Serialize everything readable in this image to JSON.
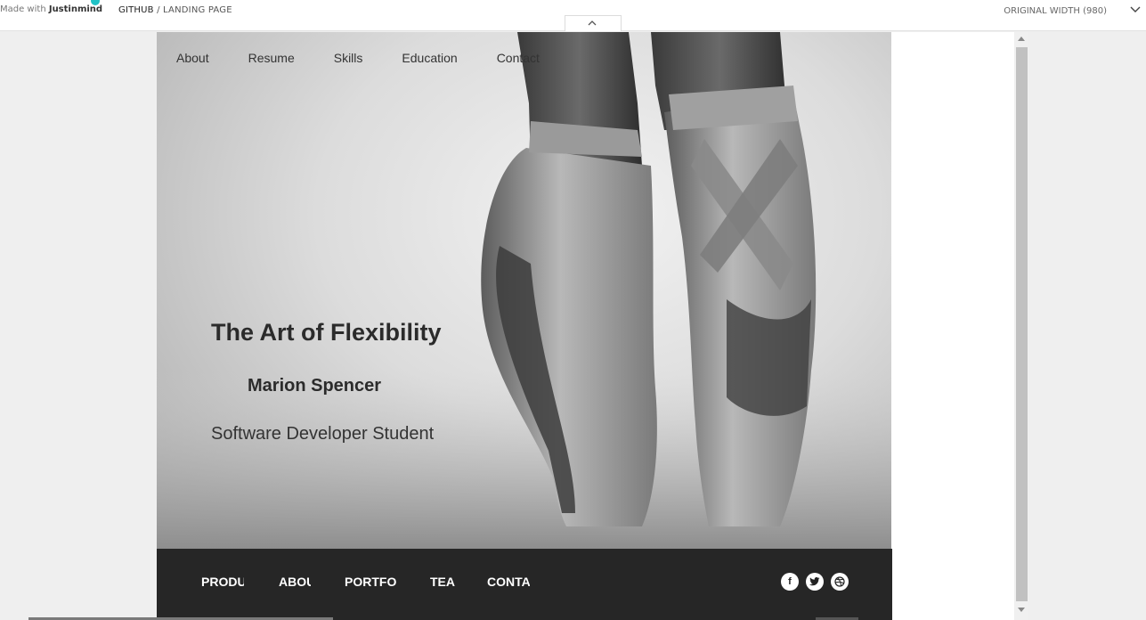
{
  "topbar": {
    "brand_prefix": "Made with",
    "brand_name": "Justinmind",
    "crumb_project": "GITHUB",
    "crumb_sep": " / ",
    "crumb_page": "LANDING PAGE",
    "width_label": "ORIGINAL WIDTH (980)"
  },
  "nav": {
    "items": [
      "About",
      "Resume",
      "Skills",
      "Education",
      "Contact"
    ]
  },
  "hero": {
    "title": "The Art of Flexibility",
    "name": "Marion Spencer",
    "role": "Software Developer Student"
  },
  "footer": {
    "items": [
      "PRODU",
      "ABOU",
      "PORTFOI",
      "TEA",
      "CONTA"
    ],
    "social": [
      "f",
      "t",
      "d"
    ]
  },
  "icons": {
    "collapse": "chevron-up-icon",
    "width_dropdown": "chevron-down-icon",
    "facebook": "facebook-icon",
    "twitter": "twitter-icon",
    "dribbble": "dribbble-icon"
  },
  "colors": {
    "brand_accent": "#1fc2c6",
    "footer_bg": "#262626"
  }
}
